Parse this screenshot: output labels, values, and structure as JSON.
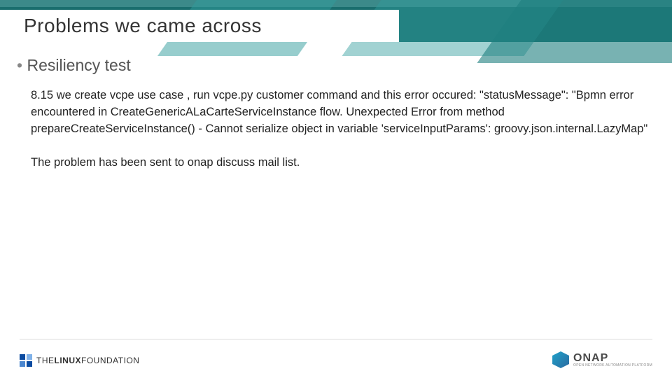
{
  "title": "Problems we came across",
  "bullet1": "Resiliency test",
  "para1": "8.15 we create vcpe use case , run vcpe.py customer command and this error occured:     \"statusMessage\": \"Bpmn error encountered in CreateGenericALaCarteServiceInstance flow. Unexpected Error from method prepareCreateServiceInstance() - Cannot serialize object in variable 'serviceInputParams': groovy.json.internal.LazyMap\"",
  "para2": "The problem has been sent to onap discuss mail list.",
  "footer": {
    "linux_prefix": "THE",
    "linux_bold": "LINUX",
    "linux_suffix": "FOUNDATION",
    "onap_name": "ONAP",
    "onap_tag": "OPEN NETWORK AUTOMATION PLATFORM"
  }
}
